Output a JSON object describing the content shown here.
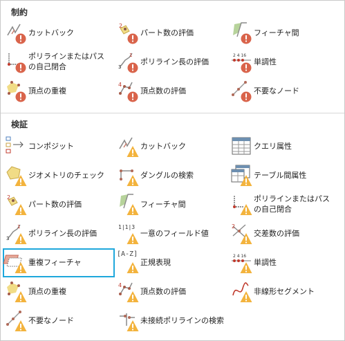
{
  "colors": {
    "error_badge": "#d9644b",
    "warning_badge": "#f3b33d",
    "accent": "#1ea7dc",
    "shape_yellow": "#f1dc86"
  },
  "constraints": {
    "title": "制約",
    "items": [
      {
        "label": "カットバック",
        "icon": "cutback-error-icon"
      },
      {
        "label": "パート数の評価",
        "icon": "part-count-error-icon"
      },
      {
        "label": "フィーチャ間",
        "icon": "feature-on-feature-error-icon"
      },
      {
        "label": "ポリラインまたはパスの自己閉合",
        "icon": "polyline-closes-on-self-error-icon"
      },
      {
        "label": "ポリライン長の評価",
        "icon": "polyline-length-error-icon"
      },
      {
        "label": "単調性",
        "icon": "monotonicity-error-icon"
      },
      {
        "label": "頂点の重複",
        "icon": "duplicate-vertex-error-icon"
      },
      {
        "label": "頂点数の評価",
        "icon": "vertex-count-error-icon"
      },
      {
        "label": "不要なノード",
        "icon": "unnecessary-node-error-icon"
      }
    ]
  },
  "validation": {
    "title": "検証",
    "items": [
      {
        "label": "コンポジット",
        "icon": "composite-icon"
      },
      {
        "label": "カットバック",
        "icon": "cutback-warning-icon"
      },
      {
        "label": "クエリ属性",
        "icon": "query-attribute-icon"
      },
      {
        "label": "ジオメトリのチェック",
        "icon": "geometry-check-warning-icon"
      },
      {
        "label": "ダングルの検索",
        "icon": "find-dangles-warning-icon"
      },
      {
        "label": "テーブル間属性",
        "icon": "table-to-table-attribute-warning-icon"
      },
      {
        "label": "パート数の評価",
        "icon": "part-count-warning-icon"
      },
      {
        "label": "フィーチャ間",
        "icon": "feature-on-feature-warning-icon"
      },
      {
        "label": "ポリラインまたはパスの自己閉合",
        "icon": "polyline-closes-on-self-warning-icon"
      },
      {
        "label": "ポリライン長の評価",
        "icon": "polyline-length-warning-icon"
      },
      {
        "label": "一意のフィールド値",
        "icon": "unique-field-value-warning-icon"
      },
      {
        "label": "交差数の評価",
        "icon": "intersection-count-warning-icon"
      },
      {
        "label": "重複フィーチャ",
        "icon": "duplicate-feature-warning-icon",
        "selected": true
      },
      {
        "label": "正規表現",
        "icon": "regular-expression-warning-icon",
        "glyph": "[A-Z]"
      },
      {
        "label": "単調性",
        "icon": "monotonicity-warning-icon"
      },
      {
        "label": "頂点の重複",
        "icon": "duplicate-vertex-warning-icon"
      },
      {
        "label": "頂点数の評価",
        "icon": "vertex-count-warning-icon"
      },
      {
        "label": "非線形セグメント",
        "icon": "nonlinear-segment-warning-icon"
      },
      {
        "label": "不要なノード",
        "icon": "unnecessary-node-warning-icon"
      },
      {
        "label": "未接続ポリラインの検索",
        "icon": "unconnected-polyline-warning-icon"
      }
    ]
  }
}
